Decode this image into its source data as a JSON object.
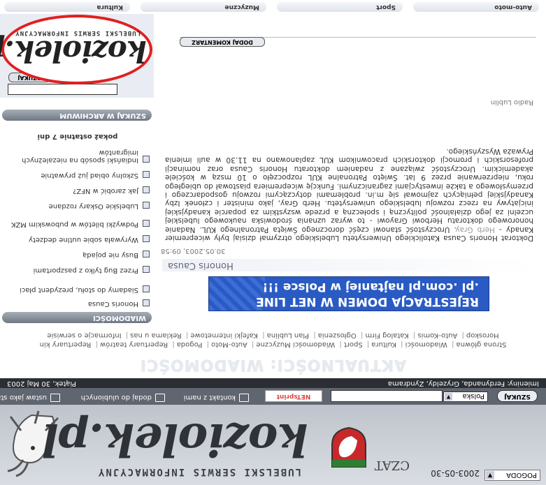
{
  "header": {
    "brand_sub": "LUBELSKI SERWIS INFORMACYJNY",
    "brand": "koziolek.pl",
    "czat": "CZAT",
    "date": "2003-05-30",
    "weather_label": "POGODA"
  },
  "toolbar": {
    "contact_label": "kontakt z nami",
    "favorites_label": "dodaj do ulubionych",
    "startpage_label": "ustaw jako startową",
    "netsprint_label": "NETsprint",
    "search_scope": "Polska",
    "search_button": "SZUKAJ"
  },
  "datebar": {
    "day": "Piątek, 30 Maj 2003",
    "nameday": "Imieniny: Ferdynanda, Gryzeldy, Zyndrama"
  },
  "heading": "AKTUALNOŚCI: WIADOMOŚCI",
  "footer_nav": {
    "row1": [
      "Strona główna",
      "Wiadomości",
      "Kultura",
      "Sport",
      "Wiadomości Muzyczne",
      "Auto-Moto",
      "Pogoda",
      "Repertuary teatrów",
      "Repertuary kin"
    ],
    "row2": [
      "Horoskop",
      "Auto-Komis",
      "Katalog Firm",
      "Ogłoszenia",
      "Plan Lublina",
      "Kafejki internetowe",
      "Reklama u nas",
      "Informacje o serwisie"
    ]
  },
  "sidebar": {
    "logo_text": "koziolek.pl",
    "logo_sub": "LUBELSKI SERWIS INFORMACYJNY",
    "search_button": "SZUKAJ",
    "archive_header": "SZUKAJ W ARCHIWUM",
    "show_last": "pokaż ostatnie 7 dni",
    "news_header": "WIADOMOŚCI",
    "news": [
      "Indiański sposób na niezależnych imigrantów",
      "Szkolny obiad już prywatnie",
      "Jak zarobić w NFZ?",
      "Lubelskie Oskary rozdane",
      "Podwyżki biletów w pubowskim MZK",
      "Wyrywała sobie uutlne dedzety",
      "Busy nie pojadą",
      "Przez Bug tylko z paszportami",
      "Siadamy do stołu, prezydent płaci",
      "Honoris Causa"
    ]
  },
  "content": {
    "banner_line1": "REJESTRACJA DOMEN W NET LINE",
    "banner_line2": ".pl   .com.pl   najtaniej w Polsce !!!",
    "article_title": "Honoris Causa",
    "article_date": "30.05.2003, 09:58",
    "article_body_1": "Doktorat Honoris Causa Katolickiego Uniwersytetu Lubelskiego otrzymał dzisiaj były wicepremier Kanady -",
    "article_body_link": "Herb Gray",
    "article_body_2": ". Uroczystość stanowi część dorocznego Święta Patronalnego KUL. Nadanie honorowego doktoratu Herbowi Grayowi - to wyraz uznania środowiska naukowego lubelskiej uczelni za jego działalność polityczną i społeczną a przede wszystkim za poparcie kanadyjskiej inicjatywy na rzecz rozwoju lubelskiego uniwersytetu. Herb Gray, jako minister i członek Izby Kanadyjskiej pełniących zajmował się m.in. problemami dotyczącymi rozwoju gospodarczego i przemysłowego a także inwestycjami zagranicznymi. Funkcję wicepremiera piastował do ubiegłego roku, nieprzerwanie przez 9 lat. Święto Patronalne KUL rozpoczęło o 10 mszą w kościele akademickim. Uroczystość związane z nadaniem doktoratu Honoris Causa oraz nominacji profesorskich i promocji doktorskich pracownikom KUL zaplanowano na 11.30 w auli imienia Pryważa Wyszyńskiego.",
    "article_source": "Radio Lublin",
    "comment_button": "DODAJ KOMENTARZ"
  },
  "categories": [
    "Auto-moto",
    "Sport",
    "Muzyczne",
    "Kultura"
  ]
}
